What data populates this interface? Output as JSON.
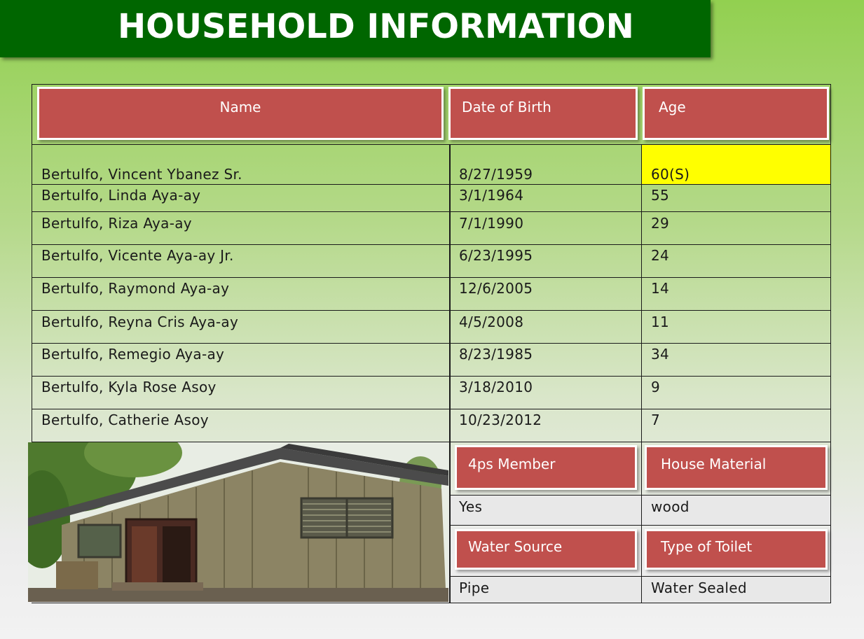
{
  "page": {
    "title": "HOUSEHOLD INFORMATION"
  },
  "members_table": {
    "headers": {
      "name": "Name",
      "dob": "Date of Birth",
      "age": "Age"
    },
    "rows": [
      {
        "name": "Bertulfo, Vincent Ybanez  Sr.",
        "dob": "8/27/1959",
        "age": "60(S)"
      },
      {
        "name": "Bertulfo, Linda Aya-ay",
        "dob": "3/1/1964",
        "age": "55"
      },
      {
        "name": "Bertulfo, Riza Aya-ay",
        "dob": "7/1/1990",
        "age": "29"
      },
      {
        "name": "Bertulfo, Vicente Aya-ay  Jr.",
        "dob": "6/23/1995",
        "age": "24"
      },
      {
        "name": " Bertulfo,  Raymond  Aya-ay",
        "dob": "12/6/2005",
        "age": "14"
      },
      {
        "name": " Bertulfo, Reyna Cris Aya-ay",
        "dob": "4/5/2008",
        "age": "11"
      },
      {
        "name": "Bertulfo, Remegio Aya-ay",
        "dob": "8/23/1985",
        "age": "34"
      },
      {
        "name": "Bertulfo, Kyla Rose Asoy",
        "dob": "3/18/2010",
        "age": "9"
      },
      {
        "name": "Bertulfo, Catherie Asoy",
        "dob": "10/23/2012",
        "age": "7"
      }
    ],
    "highlight_color": "#ffff00"
  },
  "household_details": {
    "fourps_label": "4ps Member",
    "fourps_value": "Yes",
    "house_material_label": "House Material",
    "house_material_value": "wood",
    "water_source_label": "Water Source",
    "water_source_value": "Pipe",
    "toilet_label": "Type of Toilet",
    "toilet_value": "Water Sealed"
  },
  "colors": {
    "banner": "#006600",
    "header_box": "#c0504d"
  }
}
